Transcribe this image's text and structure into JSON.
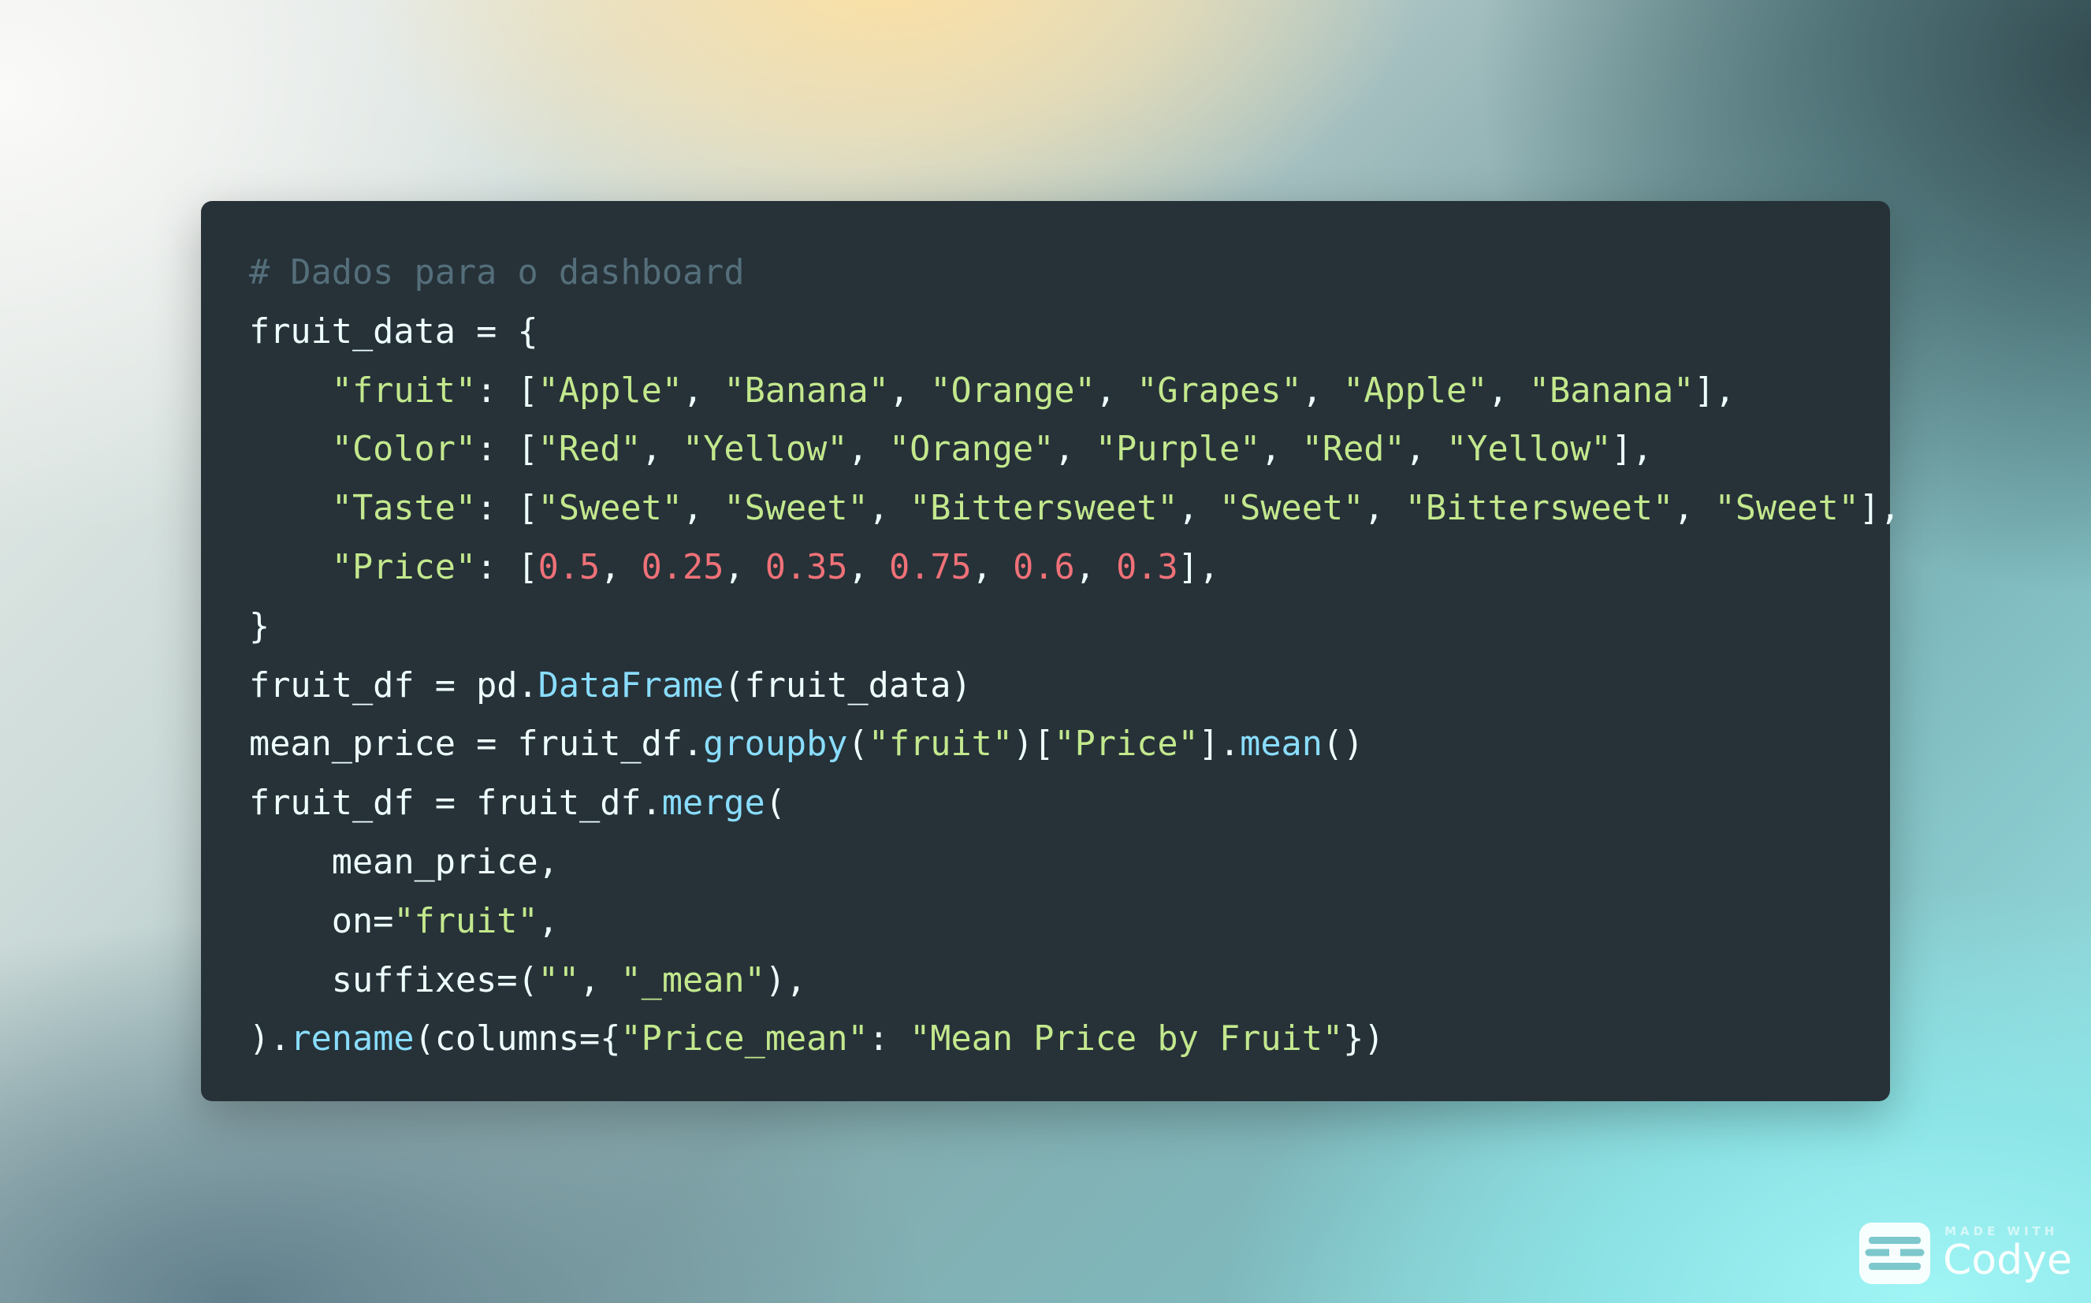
{
  "code": {
    "language": "python",
    "lines": [
      [
        {
          "t": "# Dados para o dashboard",
          "k": "c"
        }
      ],
      [
        {
          "t": "fruit_data = {",
          "k": "p"
        }
      ],
      [
        {
          "t": "    ",
          "k": "p"
        },
        {
          "t": "\"fruit\"",
          "k": "s"
        },
        {
          "t": ": [",
          "k": "p"
        },
        {
          "t": "\"Apple\"",
          "k": "s"
        },
        {
          "t": ", ",
          "k": "p"
        },
        {
          "t": "\"Banana\"",
          "k": "s"
        },
        {
          "t": ", ",
          "k": "p"
        },
        {
          "t": "\"Orange\"",
          "k": "s"
        },
        {
          "t": ", ",
          "k": "p"
        },
        {
          "t": "\"Grapes\"",
          "k": "s"
        },
        {
          "t": ", ",
          "k": "p"
        },
        {
          "t": "\"Apple\"",
          "k": "s"
        },
        {
          "t": ", ",
          "k": "p"
        },
        {
          "t": "\"Banana\"",
          "k": "s"
        },
        {
          "t": "],",
          "k": "p"
        }
      ],
      [
        {
          "t": "    ",
          "k": "p"
        },
        {
          "t": "\"Color\"",
          "k": "s"
        },
        {
          "t": ": [",
          "k": "p"
        },
        {
          "t": "\"Red\"",
          "k": "s"
        },
        {
          "t": ", ",
          "k": "p"
        },
        {
          "t": "\"Yellow\"",
          "k": "s"
        },
        {
          "t": ", ",
          "k": "p"
        },
        {
          "t": "\"Orange\"",
          "k": "s"
        },
        {
          "t": ", ",
          "k": "p"
        },
        {
          "t": "\"Purple\"",
          "k": "s"
        },
        {
          "t": ", ",
          "k": "p"
        },
        {
          "t": "\"Red\"",
          "k": "s"
        },
        {
          "t": ", ",
          "k": "p"
        },
        {
          "t": "\"Yellow\"",
          "k": "s"
        },
        {
          "t": "],",
          "k": "p"
        }
      ],
      [
        {
          "t": "    ",
          "k": "p"
        },
        {
          "t": "\"Taste\"",
          "k": "s"
        },
        {
          "t": ": [",
          "k": "p"
        },
        {
          "t": "\"Sweet\"",
          "k": "s"
        },
        {
          "t": ", ",
          "k": "p"
        },
        {
          "t": "\"Sweet\"",
          "k": "s"
        },
        {
          "t": ", ",
          "k": "p"
        },
        {
          "t": "\"Bittersweet\"",
          "k": "s"
        },
        {
          "t": ", ",
          "k": "p"
        },
        {
          "t": "\"Sweet\"",
          "k": "s"
        },
        {
          "t": ", ",
          "k": "p"
        },
        {
          "t": "\"Bittersweet\"",
          "k": "s"
        },
        {
          "t": ", ",
          "k": "p"
        },
        {
          "t": "\"Sweet\"",
          "k": "s"
        },
        {
          "t": "],",
          "k": "p"
        }
      ],
      [
        {
          "t": "    ",
          "k": "p"
        },
        {
          "t": "\"Price\"",
          "k": "s"
        },
        {
          "t": ": [",
          "k": "p"
        },
        {
          "t": "0.5",
          "k": "n"
        },
        {
          "t": ", ",
          "k": "p"
        },
        {
          "t": "0.25",
          "k": "n"
        },
        {
          "t": ", ",
          "k": "p"
        },
        {
          "t": "0.35",
          "k": "n"
        },
        {
          "t": ", ",
          "k": "p"
        },
        {
          "t": "0.75",
          "k": "n"
        },
        {
          "t": ", ",
          "k": "p"
        },
        {
          "t": "0.6",
          "k": "n"
        },
        {
          "t": ", ",
          "k": "p"
        },
        {
          "t": "0.3",
          "k": "n"
        },
        {
          "t": "],",
          "k": "p"
        }
      ],
      [
        {
          "t": "}",
          "k": "p"
        }
      ],
      [
        {
          "t": "fruit_df = pd.",
          "k": "p"
        },
        {
          "t": "DataFrame",
          "k": "f"
        },
        {
          "t": "(fruit_data)",
          "k": "p"
        }
      ],
      [
        {
          "t": "mean_price = fruit_df.",
          "k": "p"
        },
        {
          "t": "groupby",
          "k": "f"
        },
        {
          "t": "(",
          "k": "p"
        },
        {
          "t": "\"fruit\"",
          "k": "s"
        },
        {
          "t": ")[",
          "k": "p"
        },
        {
          "t": "\"Price\"",
          "k": "s"
        },
        {
          "t": "].",
          "k": "p"
        },
        {
          "t": "mean",
          "k": "f"
        },
        {
          "t": "()",
          "k": "p"
        }
      ],
      [
        {
          "t": "fruit_df = fruit_df.",
          "k": "p"
        },
        {
          "t": "merge",
          "k": "f"
        },
        {
          "t": "(",
          "k": "p"
        }
      ],
      [
        {
          "t": "    mean_price,",
          "k": "p"
        }
      ],
      [
        {
          "t": "    on=",
          "k": "p"
        },
        {
          "t": "\"fruit\"",
          "k": "s"
        },
        {
          "t": ",",
          "k": "p"
        }
      ],
      [
        {
          "t": "    suffixes=(",
          "k": "p"
        },
        {
          "t": "\"\"",
          "k": "s"
        },
        {
          "t": ", ",
          "k": "p"
        },
        {
          "t": "\"_mean\"",
          "k": "s"
        },
        {
          "t": "),",
          "k": "p"
        }
      ],
      [
        {
          "t": ").",
          "k": "p"
        },
        {
          "t": "rename",
          "k": "f"
        },
        {
          "t": "(columns={",
          "k": "p"
        },
        {
          "t": "\"Price_mean\"",
          "k": "s"
        },
        {
          "t": ": ",
          "k": "p"
        },
        {
          "t": "\"Mean Price by Fruit\"",
          "k": "s"
        },
        {
          "t": "})",
          "k": "p"
        }
      ]
    ]
  },
  "badge": {
    "made_with": "MADE WITH",
    "brand": "Codye",
    "icon": "codye-logo-icon"
  },
  "colors": {
    "panel_bg": "#263238",
    "comment": "#546e7a",
    "string": "#c3e88d",
    "number": "#f07178",
    "function": "#89ddff",
    "plain": "#eeffff"
  }
}
